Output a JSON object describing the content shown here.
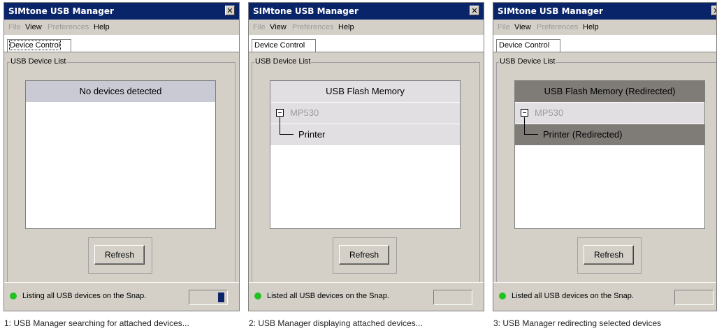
{
  "colors": {
    "titlebar": "#0a246a",
    "window_face": "#d4d0c8",
    "row_empty": "#c9cad4",
    "row_plain": "#e2dfe2",
    "row_redirected": "#7f7b77",
    "status_ok": "#21c121",
    "progress_fill": "#0a246a"
  },
  "icons": {
    "close": "close-icon",
    "status": "status-dot-icon",
    "expander": "collapse-icon"
  },
  "windows": [
    {
      "title": "SIMtone USB Manager",
      "menu": [
        "File",
        "View",
        "Preferences",
        "Help"
      ],
      "tab": "Device Control",
      "group_label": "USB Device List",
      "empty_message": "No devices detected",
      "refresh_label": "Refresh",
      "status": "Listing all USB devices on the Snap.",
      "progress_percent": 15,
      "caption": "1: USB Manager searching for attached devices..."
    },
    {
      "title": "SIMtone USB Manager",
      "menu": [
        "File",
        "View",
        "Preferences",
        "Help"
      ],
      "tab": "Device Control",
      "group_label": "USB Device List",
      "devices": [
        "USB Flash Memory",
        "MP530",
        "Printer"
      ],
      "refresh_label": "Refresh",
      "status": "Listed all USB devices on the Snap.",
      "progress_percent": 0,
      "caption": "2:  USB Manager displaying attached devices..."
    },
    {
      "title": "SIMtone USB Manager",
      "menu": [
        "File",
        "View",
        "Preferences",
        "Help"
      ],
      "tab": "Device Control",
      "group_label": "USB Device List",
      "devices": [
        "USB Flash Memory (Redirected)",
        "MP530",
        "Printer (Redirected)"
      ],
      "refresh_label": "Refresh",
      "status": "Listed all USB devices on the Snap.",
      "progress_percent": 0,
      "caption": "3:   USB Manager redirecting selected devices"
    }
  ]
}
